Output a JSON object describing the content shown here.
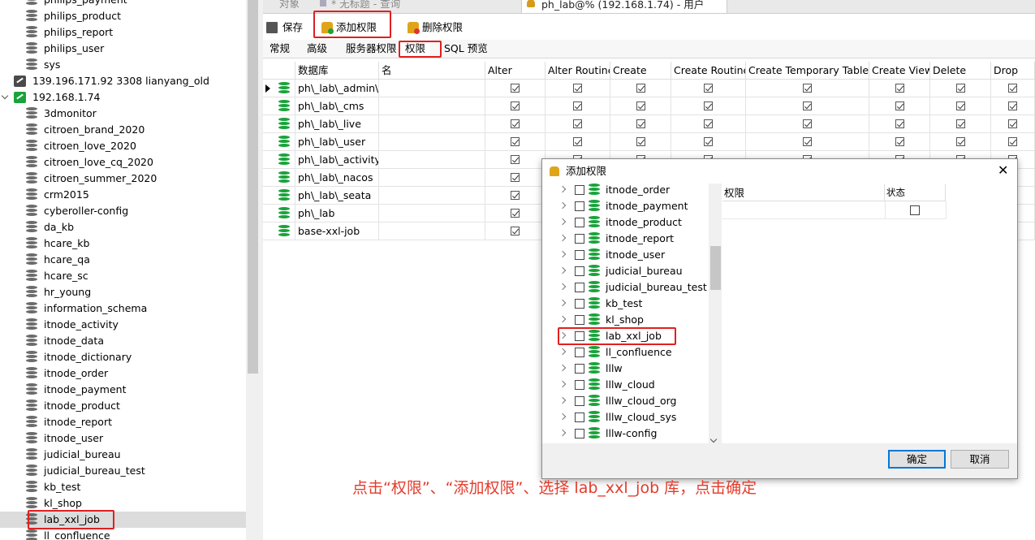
{
  "tree": {
    "items": [
      {
        "label": "philips_payment",
        "type": "db"
      },
      {
        "label": "philips_product",
        "type": "db"
      },
      {
        "label": "philips_report",
        "type": "db"
      },
      {
        "label": "philips_user",
        "type": "db"
      },
      {
        "label": "sys",
        "type": "db"
      },
      {
        "label": "139.196.171.92 3308 lianyang_old",
        "type": "server"
      },
      {
        "label": "192.168.1.74",
        "type": "server-open"
      },
      {
        "label": "3dmonitor",
        "type": "db"
      },
      {
        "label": "citroen_brand_2020",
        "type": "db"
      },
      {
        "label": "citroen_love_2020",
        "type": "db"
      },
      {
        "label": "citroen_love_cq_2020",
        "type": "db"
      },
      {
        "label": "citroen_summer_2020",
        "type": "db"
      },
      {
        "label": "crm2015",
        "type": "db"
      },
      {
        "label": "cyberoller-config",
        "type": "db"
      },
      {
        "label": "da_kb",
        "type": "db"
      },
      {
        "label": "hcare_kb",
        "type": "db"
      },
      {
        "label": "hcare_qa",
        "type": "db"
      },
      {
        "label": "hcare_sc",
        "type": "db"
      },
      {
        "label": "hr_young",
        "type": "db"
      },
      {
        "label": "information_schema",
        "type": "db"
      },
      {
        "label": "itnode_activity",
        "type": "db"
      },
      {
        "label": "itnode_data",
        "type": "db"
      },
      {
        "label": "itnode_dictionary",
        "type": "db"
      },
      {
        "label": "itnode_order",
        "type": "db"
      },
      {
        "label": "itnode_payment",
        "type": "db"
      },
      {
        "label": "itnode_product",
        "type": "db"
      },
      {
        "label": "itnode_report",
        "type": "db"
      },
      {
        "label": "itnode_user",
        "type": "db"
      },
      {
        "label": "judicial_bureau",
        "type": "db"
      },
      {
        "label": "judicial_bureau_test",
        "type": "db"
      },
      {
        "label": "kb_test",
        "type": "db"
      },
      {
        "label": "kl_shop",
        "type": "db"
      },
      {
        "label": "lab_xxl_job",
        "type": "db",
        "selected": true
      },
      {
        "label": "ll_confluence",
        "type": "db"
      }
    ]
  },
  "doc_tabs": [
    "对象",
    "* 无标题 - 查询",
    "ph_lab@% (192.168.1.74) - 用户"
  ],
  "toolbar": {
    "save": "保存",
    "add_priv": "添加权限",
    "del_priv": "删除权限"
  },
  "subtabs": [
    "常规",
    "高级",
    "服务器权限",
    "权限",
    "SQL 预览"
  ],
  "grid": {
    "headers": [
      "数据库",
      "名",
      "Alter",
      "Alter Routine",
      "Create",
      "Create Routine",
      "Create Temporary Tables",
      "Create View",
      "Delete",
      "Drop"
    ],
    "rows": [
      "ph\\_lab\\_admin\\_",
      "ph\\_lab\\_cms",
      "ph\\_lab\\_live",
      "ph\\_lab\\_user",
      "ph\\_lab\\_activity",
      "ph\\_lab\\_nacos",
      "ph\\_lab\\_seata",
      "ph\\_lab",
      "base-xxl-job"
    ]
  },
  "dialog": {
    "title": "添加权限",
    "items": [
      "itnode_order",
      "itnode_payment",
      "itnode_product",
      "itnode_report",
      "itnode_user",
      "judicial_bureau",
      "judicial_bureau_test",
      "kb_test",
      "kl_shop",
      "lab_xxl_job",
      "ll_confluence",
      "lllw",
      "lllw_cloud",
      "lllw_cloud_org",
      "lllw_cloud_sys",
      "lllw-config"
    ],
    "col_priv": "权限",
    "col_status": "状态",
    "ok": "确定",
    "cancel": "取消"
  },
  "annotation": "点击“权限”、“添加权限”、选择 lab_xxl_job 库，点击确定",
  "colors": {
    "highlight": "#e02020",
    "db_green": "#19a33a",
    "note_red": "#e43b2c",
    "selection": "#cce4f7"
  }
}
